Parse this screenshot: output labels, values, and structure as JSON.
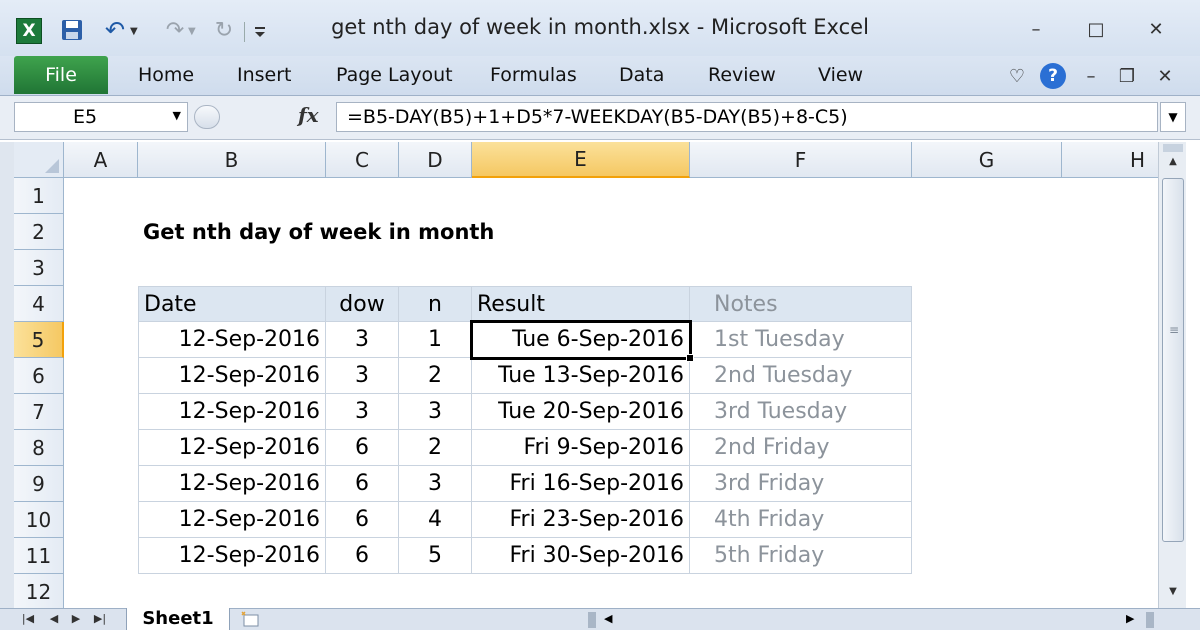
{
  "window": {
    "title": "get nth day of week in month.xlsx  -  Microsoft Excel",
    "app_logo": "X",
    "minimize": "–",
    "restore": "□",
    "close": "✕"
  },
  "quick_access": {
    "icons": [
      "excel-logo-icon",
      "save-icon",
      "undo-icon",
      "redo-icon",
      "repeat-icon",
      "customize-icon"
    ]
  },
  "ribbon": {
    "file_label": "File",
    "tabs": [
      "Home",
      "Insert",
      "Page Layout",
      "Formulas",
      "Data",
      "Review",
      "View"
    ],
    "right_icons": [
      "minimize-ribbon-icon",
      "help-icon",
      "window-minimize-icon",
      "window-restore-icon",
      "window-close-icon"
    ],
    "help_glyph": "?"
  },
  "formula_bar": {
    "name_box": "E5",
    "fx": "fx",
    "formula": "=B5-DAY(B5)+1+D5*7-WEEKDAY(B5-DAY(B5)+8-C5)"
  },
  "grid": {
    "columns": [
      "A",
      "B",
      "C",
      "D",
      "E",
      "F",
      "G",
      "H"
    ],
    "selected_column": "E",
    "rows": [
      "1",
      "2",
      "3",
      "4",
      "5",
      "6",
      "7",
      "8",
      "9",
      "10",
      "11",
      "12"
    ],
    "selected_row": "5",
    "active_cell": "E5"
  },
  "sheet": {
    "title": "Get nth day of week in month",
    "table": {
      "headers": [
        "Date",
        "dow",
        "n",
        "Result",
        "Notes"
      ],
      "rows": [
        [
          "12-Sep-2016",
          "3",
          "1",
          "Tue 6-Sep-2016",
          "1st Tuesday"
        ],
        [
          "12-Sep-2016",
          "3",
          "2",
          "Tue 13-Sep-2016",
          "2nd Tuesday"
        ],
        [
          "12-Sep-2016",
          "3",
          "3",
          "Tue 20-Sep-2016",
          "3rd Tuesday"
        ],
        [
          "12-Sep-2016",
          "6",
          "2",
          "Fri 9-Sep-2016",
          "2nd Friday"
        ],
        [
          "12-Sep-2016",
          "6",
          "3",
          "Fri 16-Sep-2016",
          "3rd Friday"
        ],
        [
          "12-Sep-2016",
          "6",
          "4",
          "Fri 23-Sep-2016",
          "4th Friday"
        ],
        [
          "12-Sep-2016",
          "6",
          "5",
          "Fri 30-Sep-2016",
          "5th Friday"
        ]
      ]
    }
  },
  "sheet_tabs": {
    "active": "Sheet1"
  },
  "colors": {
    "file_tab": "#2f8c40",
    "header_fill": "#dce6f1",
    "selection_header": "#f5c863",
    "notes_text": "#8c939b"
  }
}
